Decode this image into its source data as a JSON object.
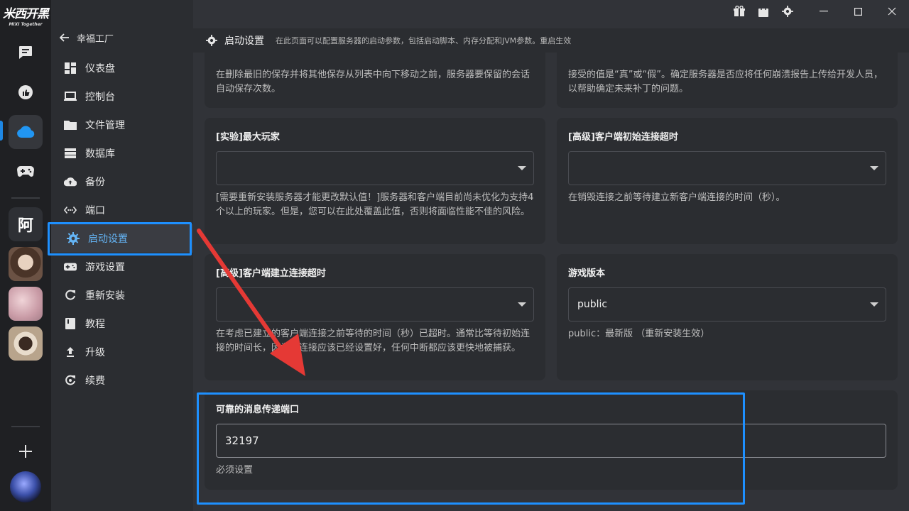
{
  "app": {
    "logo_text": "米西开黑",
    "logo_sub": "MIXI Together"
  },
  "rail": {
    "server_char": "阿"
  },
  "nav": {
    "back_label": "幸福工厂",
    "items": [
      {
        "label": "仪表盘",
        "icon": "dashboard-icon"
      },
      {
        "label": "控制台",
        "icon": "laptop-icon"
      },
      {
        "label": "文件管理",
        "icon": "folder-icon"
      },
      {
        "label": "数据库",
        "icon": "database-icon"
      },
      {
        "label": "备份",
        "icon": "cloud-upload-icon"
      },
      {
        "label": "端口",
        "icon": "port-icon"
      },
      {
        "label": "启动设置",
        "icon": "gear-icon"
      },
      {
        "label": "游戏设置",
        "icon": "gamepad-settings-icon"
      },
      {
        "label": "重新安装",
        "icon": "refresh-icon"
      },
      {
        "label": "教程",
        "icon": "book-icon"
      },
      {
        "label": "升级",
        "icon": "upgrade-icon"
      },
      {
        "label": "续费",
        "icon": "renew-icon"
      }
    ],
    "active_index": 6
  },
  "header": {
    "title": "启动设置",
    "description": "在此页面可以配置服务器的启动参数，包括启动脚本、内存分配和JVM参数。重启生效"
  },
  "cards": {
    "top_left_desc": "在删除最旧的保存并将其他保存从列表中向下移动之前，服务器要保留的会话自动保存次数。",
    "top_right_desc": "接受的值是“真”或“假”。确定服务器是否应将任何崩溃报告上传给开发人员，以帮助确定未来补丁的问题。",
    "max_players": {
      "title": "[实验]最大玩家",
      "value": "",
      "desc": "[需要重新安装服务器才能更改默认值！]服务器和客户端目前尚未优化为支持4个以上的玩家。但是，您可以在此处覆盖此值，否则将面临性能不佳的风险。"
    },
    "initial_timeout": {
      "title": "[高级]客户端初始连接超时",
      "value": "",
      "desc": "在销毁连接之前等待建立新客户端连接的时间（秒）。"
    },
    "established_timeout": {
      "title": "[高级]客户端建立连接超时",
      "value": "",
      "desc": "在考虑已建立的客户端连接之前等待的时间（秒）已超时。通常比等待初始连接的时间长，因为此连接应该已经设置好，任何中断都应该更快地被捕获。"
    },
    "game_version": {
      "title": "游戏版本",
      "value": "public",
      "desc": "public：最新版 （重新安装生效）"
    },
    "messaging_port": {
      "title": "可靠的消息传递端口",
      "value": "32197",
      "desc": "必须设置"
    }
  },
  "colors": {
    "accent": "#1e90ff",
    "active_text": "#64b5f6",
    "arrow": "#e53935"
  }
}
